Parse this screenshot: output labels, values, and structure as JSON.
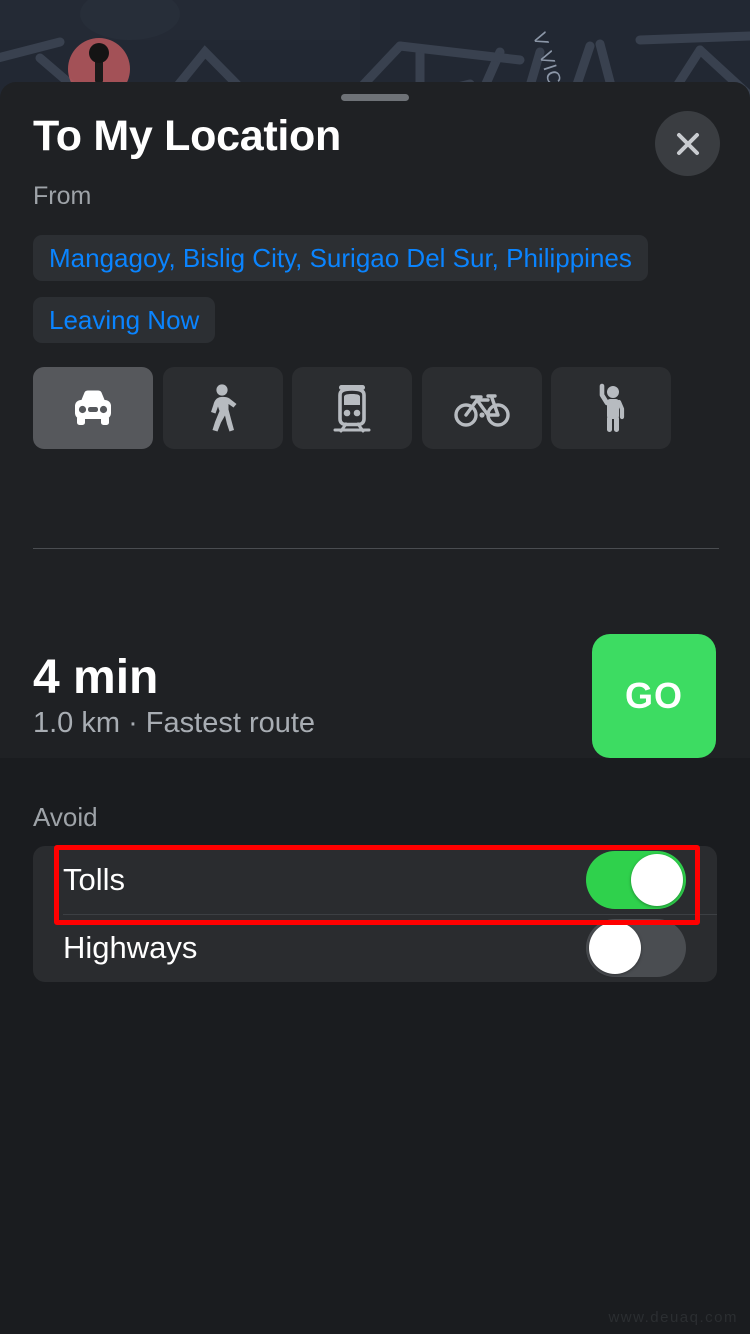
{
  "map": {
    "street_label": "V VICE",
    "pin_name": "destination-pin"
  },
  "sheet": {
    "title": "To My Location",
    "close_label": "close-icon",
    "from_label": "From",
    "origin_address": "Mangagoy, Bislig City, Surigao Del Sur, Philippines",
    "departure_chip": "Leaving Now"
  },
  "modes": [
    {
      "id": "driving",
      "icon": "car-icon",
      "selected": true
    },
    {
      "id": "walking",
      "icon": "walking-icon",
      "selected": false
    },
    {
      "id": "transit",
      "icon": "train-icon",
      "selected": false
    },
    {
      "id": "cycling",
      "icon": "bicycle-icon",
      "selected": false
    },
    {
      "id": "rideshare",
      "icon": "rideshare-icon",
      "selected": false
    }
  ],
  "route": {
    "duration": "4 min",
    "details": "1.0 km · Fastest route",
    "go_label": "GO"
  },
  "avoid": {
    "title": "Avoid",
    "options": [
      {
        "label": "Tolls",
        "enabled": true
      },
      {
        "label": "Highways",
        "enabled": false
      }
    ]
  },
  "annotation": {
    "target": "Tolls",
    "color": "#ff0000"
  },
  "watermark": "www.deuaq.com",
  "colors": {
    "accent_blue": "#0a84ff",
    "go_green": "#3ddc62",
    "toggle_on_green": "#2fd14c",
    "sheet_bg": "#1f2124",
    "avoid_bg": "#1a1c1f"
  }
}
